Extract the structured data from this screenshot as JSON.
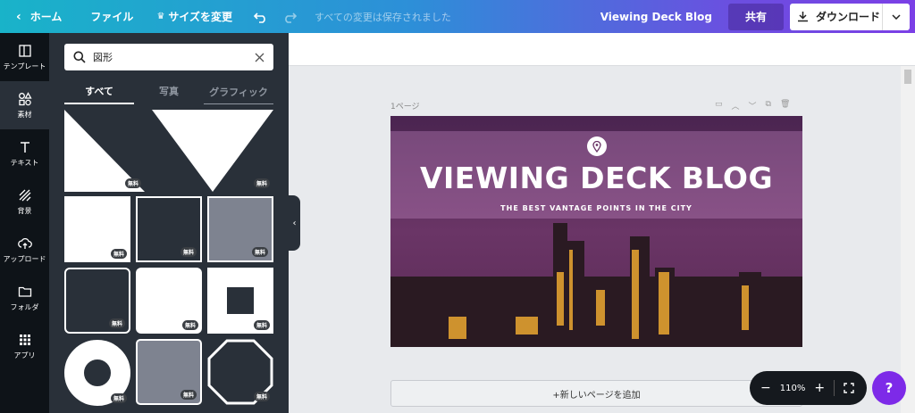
{
  "topbar": {
    "home_label": "ホーム",
    "file_label": "ファイル",
    "resize_label": "サイズを変更",
    "status_text": "すべての変更は保存されました",
    "doc_title": "Viewing Deck Blog",
    "share_label": "共有",
    "download_label": "ダウンロード"
  },
  "sidebar": {
    "items": [
      {
        "label": "テンプレート",
        "icon": "template-icon"
      },
      {
        "label": "素材",
        "icon": "elements-icon"
      },
      {
        "label": "テキスト",
        "icon": "text-icon"
      },
      {
        "label": "背景",
        "icon": "background-icon"
      },
      {
        "label": "アップロード",
        "icon": "upload-icon"
      },
      {
        "label": "フォルダ",
        "icon": "folder-icon"
      },
      {
        "label": "アプリ",
        "icon": "apps-icon"
      }
    ]
  },
  "panel": {
    "search_value": "図形",
    "tabs": [
      {
        "label": "すべて"
      },
      {
        "label": "写真"
      },
      {
        "label": "グラフィック"
      }
    ],
    "free_badge": "無料"
  },
  "editor": {
    "page_label": "1ページ",
    "add_page_label": "+新しいページを追加",
    "zoom_level": "110%"
  },
  "design": {
    "title": "VIEWING DECK BLOG",
    "subtitle": "THE BEST VANTAGE POINTS IN THE CITY"
  },
  "help": {
    "label": "?"
  },
  "colors": {
    "accent": "#7d2ae8",
    "panel_bg": "#293039",
    "sidebar_bg": "#0e1318"
  }
}
